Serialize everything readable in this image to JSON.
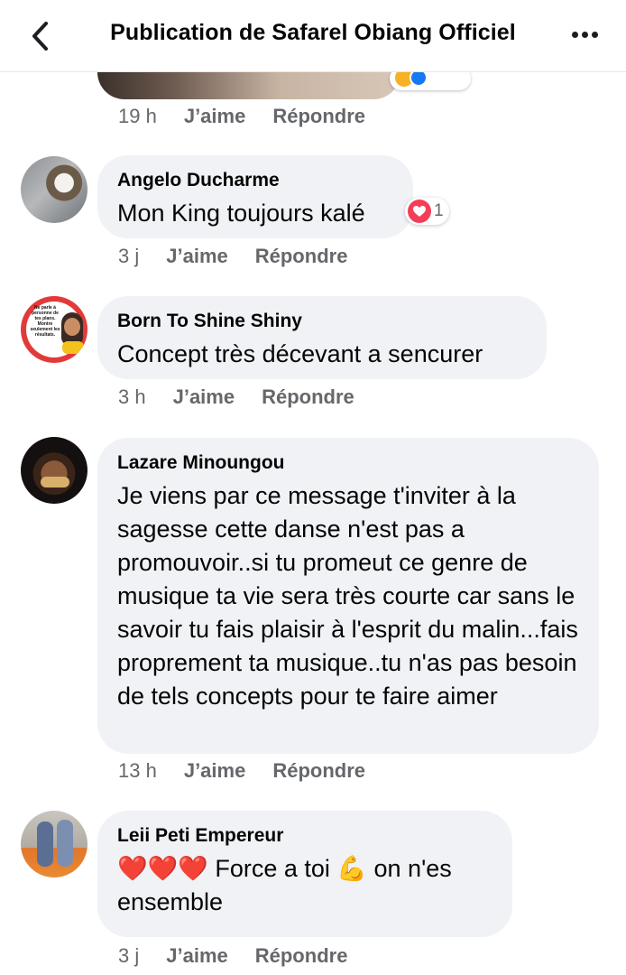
{
  "header": {
    "title": "Publication de Safarel Obiang Officiel"
  },
  "comments": [
    {
      "time": "19 h",
      "like": "J’aime",
      "reply": "Répondre"
    },
    {
      "author": "Angelo Ducharme",
      "text": "Mon King toujours kalé",
      "reaction_count": "1",
      "time": "3 j",
      "like": "J’aime",
      "reply": "Répondre"
    },
    {
      "author": "Born To Shine Shiny",
      "text": "Concept très décevant a sencurer",
      "time": "3 h",
      "like": "J’aime",
      "reply": "Répondre",
      "avatar_text": "Ne parle à personne de tes plans. Montre seulement les résultats."
    },
    {
      "author": "Lazare Minoungou",
      "text": "Je viens par ce message t'inviter à la sagesse cette danse n'est pas a promouvoir..si tu promeut ce genre de musique ta vie sera très courte car sans le savoir tu fais plaisir à l'esprit du malin...fais proprement ta musique..tu n'as pas besoin de tels concepts pour te faire aimer",
      "time": "13 h",
      "like": "J’aime",
      "reply": "Répondre"
    },
    {
      "author": "Leii Peti Empereur",
      "text_a": "❤️❤️❤️ Force a toi 💪 on n'es",
      "text_b": "ensemble",
      "time": "3 j",
      "like": "J’aime",
      "reply": "Répondre"
    }
  ],
  "icons": {
    "back": "chevron-left-icon",
    "more": "more-horizontal-icon",
    "reaction": "love-reaction-icon"
  },
  "colors": {
    "bubble": "#f0f2f5",
    "meta": "#65676b",
    "love": "#f33e58"
  }
}
